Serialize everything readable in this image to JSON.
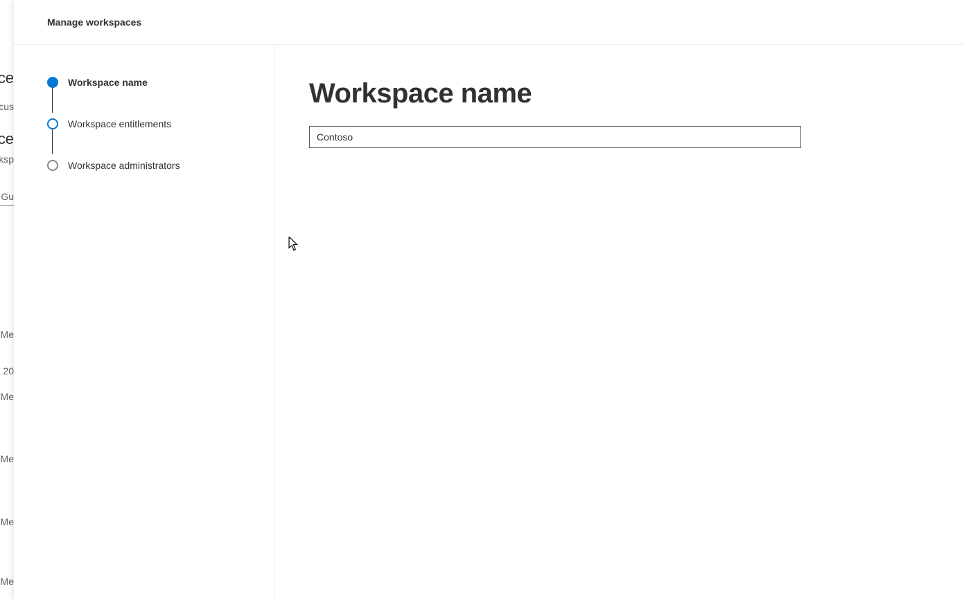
{
  "header": {
    "title": "Manage workspaces"
  },
  "sidebar": {
    "steps": [
      {
        "label": "Workspace name",
        "state": "active"
      },
      {
        "label": "Workspace entitlements",
        "state": "next"
      },
      {
        "label": "Workspace administrators",
        "state": "pending"
      }
    ]
  },
  "main": {
    "heading": "Workspace name",
    "input_value": "Contoso"
  },
  "background": {
    "frag1": "ce",
    "frag2": "cus",
    "frag3": "ce",
    "frag4": "rksp",
    "frag5": "l Gu",
    "frag6": "Me",
    "frag7": "20",
    "frag8": "Me",
    "frag9": "Me",
    "frag10": "Me",
    "frag11": "Me"
  }
}
